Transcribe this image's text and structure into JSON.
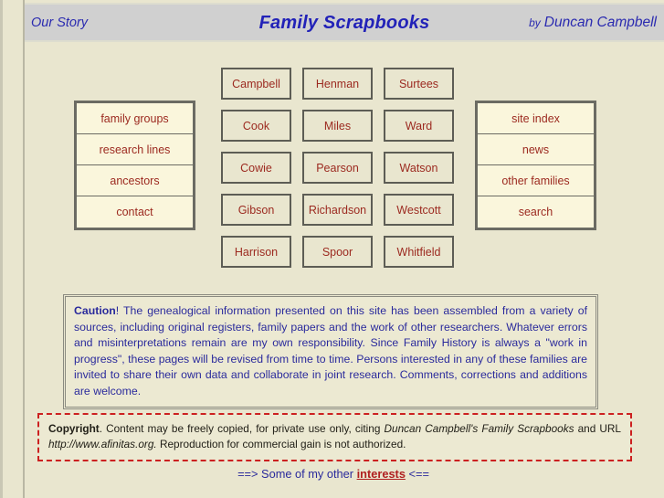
{
  "header": {
    "our_story_label": "Our Story",
    "title": "Family Scrapbooks",
    "by_word": "by",
    "author": "Duncan Campbell"
  },
  "left_nav": {
    "items": [
      {
        "label": "family groups"
      },
      {
        "label": "research lines"
      },
      {
        "label": "ancestors"
      },
      {
        "label": "contact"
      }
    ]
  },
  "right_nav": {
    "items": [
      {
        "label": "site index"
      },
      {
        "label": "news"
      },
      {
        "label": "other families"
      },
      {
        "label": "search"
      }
    ]
  },
  "surnames": {
    "rows": [
      [
        {
          "label": "Campbell"
        },
        {
          "label": "Henman"
        },
        {
          "label": "Surtees"
        }
      ],
      [
        {
          "label": "Cook"
        },
        {
          "label": "Miles"
        },
        {
          "label": "Ward"
        }
      ],
      [
        {
          "label": "Cowie"
        },
        {
          "label": "Pearson"
        },
        {
          "label": "Watson"
        }
      ],
      [
        {
          "label": "Gibson"
        },
        {
          "label": "Richardson"
        },
        {
          "label": "Westcott"
        }
      ],
      [
        {
          "label": "Harrison"
        },
        {
          "label": "Spoor"
        },
        {
          "label": "Whitfield"
        }
      ]
    ]
  },
  "caution": {
    "heading": "Caution",
    "body": "! The genealogical information presented on this site has been assembled from a variety of sources, including original registers, family papers and the work of other researchers. Whatever errors and misinterpretations remain are my own responsibility. Since Family History is always a \"work in progress\", these pages will be revised from time to time. Persons interested in any of these families are invited to share their own data and collaborate in joint research. Comments, corrections and additions are welcome."
  },
  "copyright": {
    "heading": "Copyright",
    "text_before_cite": ". Content may be freely copied, for private use only, citing ",
    "cite": "Duncan Campbell's Family Scrapbooks",
    "text_after_cite": " and URL ",
    "url": "http://www.afinitas.org.",
    "text_tail": "  Reproduction for commercial gain is not authorized."
  },
  "footer": {
    "prefix": "==> Some of my other ",
    "link_label": "interests",
    "suffix": " <=="
  },
  "colors": {
    "page_background": "#e9e6cf",
    "header_background": "#d0d0d0",
    "title_blue": "#2222b8",
    "nav_text_red": "#9c2a20",
    "caution_blue": "#2a2a9c",
    "copyright_border_red": "#cc2020",
    "link_red": "#b02020"
  }
}
